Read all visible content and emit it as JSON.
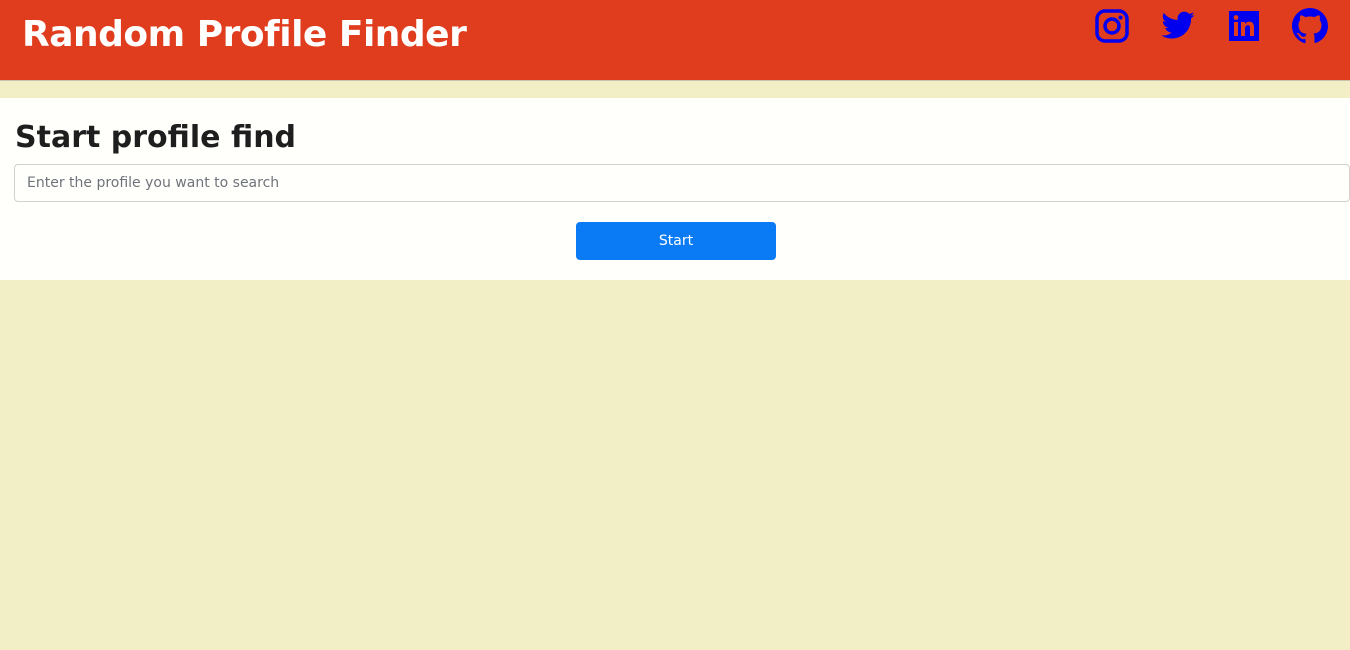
{
  "header": {
    "title": "Random Profile Finder",
    "icon_color": "#0000ee",
    "social_links": [
      {
        "icon": "instagram-icon"
      },
      {
        "icon": "twitter-icon"
      },
      {
        "icon": "linkedin-icon"
      },
      {
        "icon": "github-icon"
      }
    ]
  },
  "main": {
    "heading": "Start profile find",
    "search_placeholder": "Enter the profile you want to search",
    "search_value": "",
    "start_label": "Start"
  },
  "colors": {
    "header": "#e03d1e",
    "background": "#f2efc6",
    "button": "#0a7bf5"
  }
}
